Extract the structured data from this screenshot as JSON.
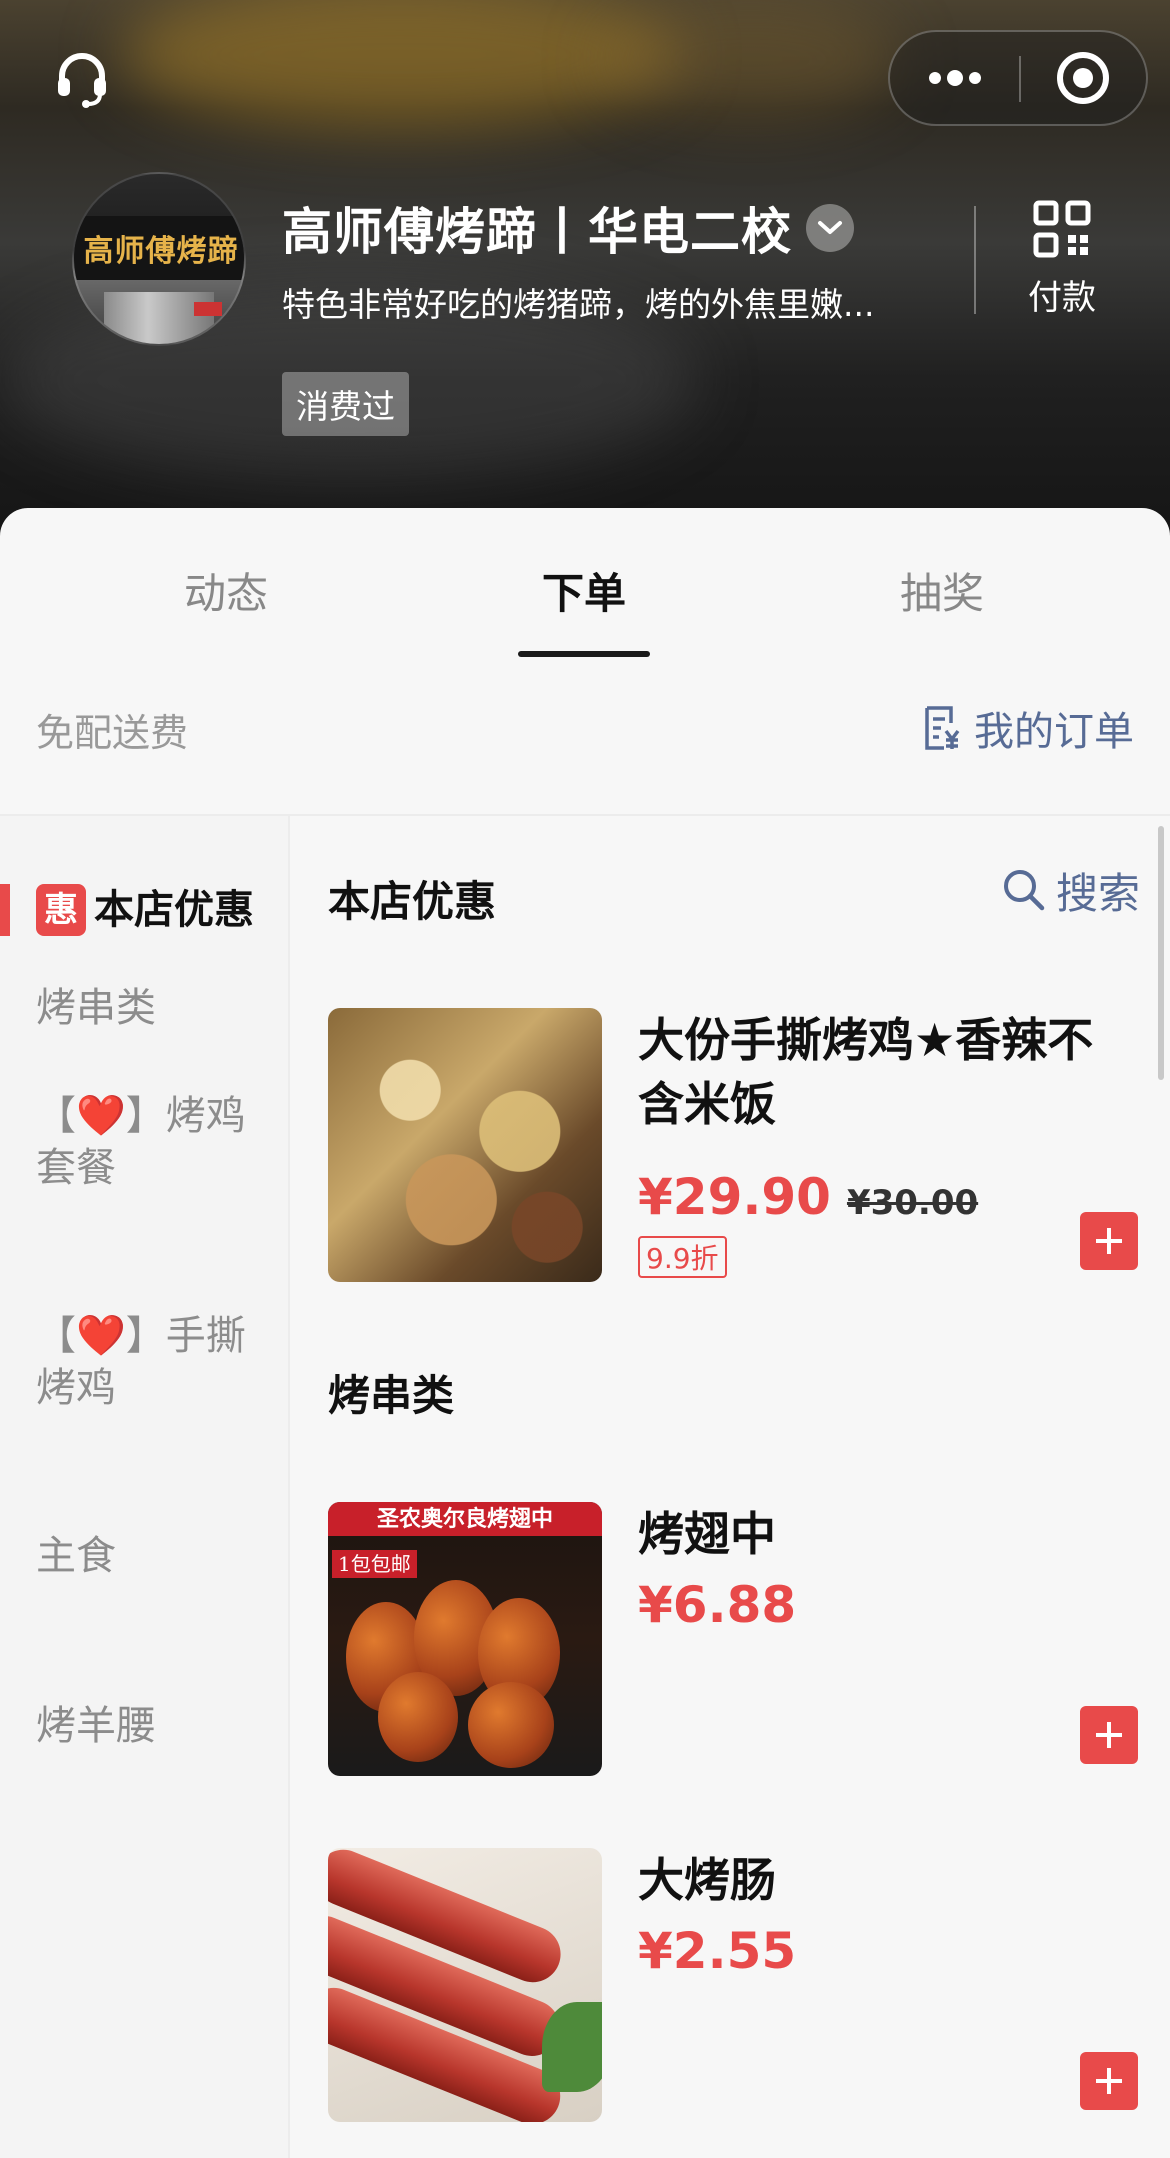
{
  "header": {
    "shop_name": "高师傅烤蹄丨华电二校",
    "shop_description": "特色非常好吃的烤猪蹄，烤的外焦里嫩...",
    "consumed_tag": "消费过",
    "pay_label": "付款",
    "avatar_sign_text": "高师傅烤蹄"
  },
  "tabs": [
    {
      "label": "动态",
      "active": false
    },
    {
      "label": "下单",
      "active": true
    },
    {
      "label": "抽奖",
      "active": false
    }
  ],
  "info_bar": {
    "delivery_note": "免配送费",
    "my_orders_label": "我的订单"
  },
  "sidebar": {
    "active_badge": "惠",
    "items": [
      {
        "label": "本店优惠",
        "active": true
      },
      {
        "label": "烤串类",
        "active": false
      },
      {
        "label": "【❤️】烤鸡套餐",
        "active": false
      },
      {
        "label": "【❤️】手撕烤鸡",
        "active": false
      },
      {
        "label": "主食",
        "active": false
      },
      {
        "label": "烤羊腰",
        "active": false
      }
    ]
  },
  "content": {
    "search_label": "搜索",
    "sections": [
      {
        "title": "本店优惠",
        "products": [
          {
            "name": "大份手撕烤鸡★香辣不含米饭",
            "price": "¥29.90",
            "original_price": "¥30.00",
            "discount": "9.9折"
          }
        ]
      },
      {
        "title": "烤串类",
        "products": [
          {
            "name": "烤翅中",
            "price": "¥6.88",
            "image_banner": "圣农奥尔良烤翅中",
            "image_tag": "1包包邮"
          },
          {
            "name": "大烤肠",
            "price": "¥2.55"
          }
        ]
      }
    ]
  },
  "colors": {
    "accent_red": "#e84a4a",
    "link_blue": "#576b95"
  },
  "icons": [
    "headset-icon",
    "more-dots-icon",
    "close-circle-icon",
    "chevron-down-icon",
    "qr-code-icon",
    "order-list-icon",
    "search-icon",
    "plus-icon"
  ]
}
